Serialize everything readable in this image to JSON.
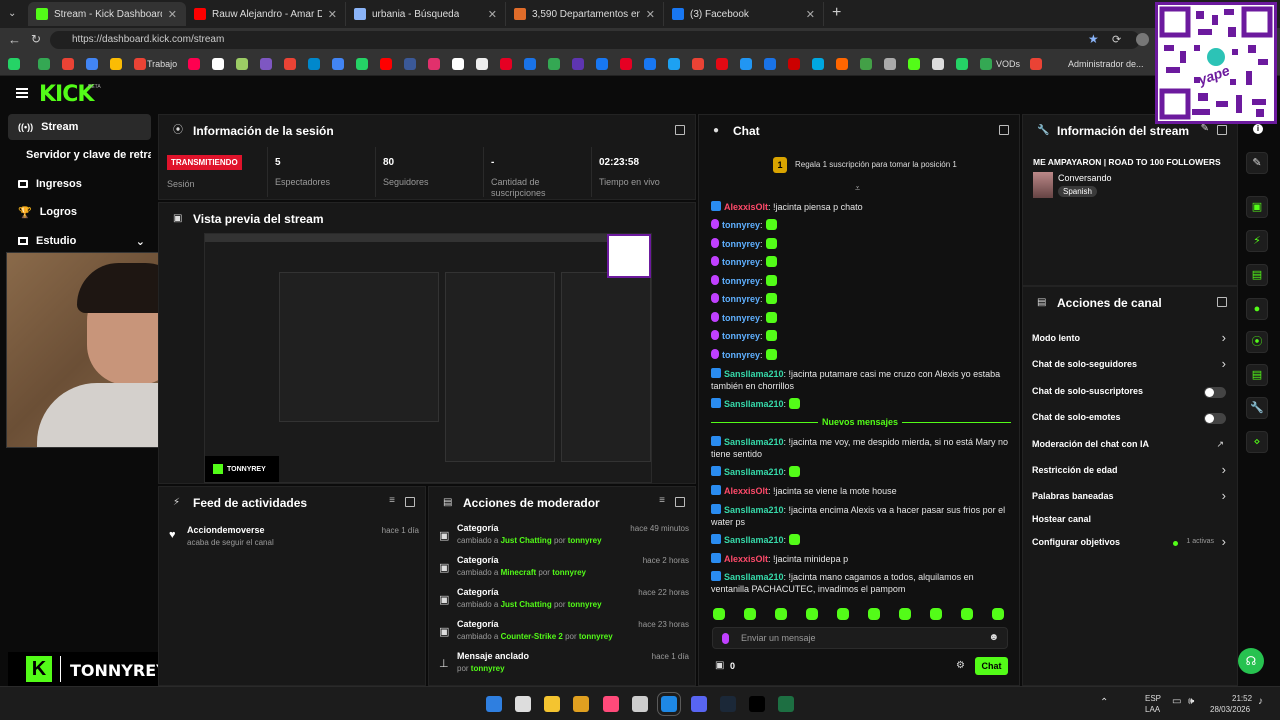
{
  "browser": {
    "tabs": [
      {
        "label": "Stream - Kick Dashboard",
        "color": "#53fc18"
      },
      {
        "label": "Rauw Alejandro - Amar De Nuevo",
        "color": "#ff0000"
      },
      {
        "label": "urbania - Búsqueda",
        "color": "#8ab4f8"
      },
      {
        "label": "3,590 Departamentos en alquiler e",
        "color": "#e06c2a"
      },
      {
        "label": "(3) Facebook",
        "color": "#1877f2"
      }
    ],
    "new_tab": "+",
    "url": "https://dashboard.kick.com/stream",
    "bookmarks": {
      "trabajo": "Trabajo",
      "vods": "VODs",
      "admin": "Administrador de..."
    }
  },
  "qr_overlay": {
    "label": "yape"
  },
  "sidebar": {
    "logo": "KICK",
    "logo_sup": "BETA",
    "items": [
      {
        "label": "Stream"
      },
      {
        "label": "Servidor y clave de retransm"
      },
      {
        "label": "Ingresos"
      },
      {
        "label": "Logros"
      },
      {
        "label": "Estudio"
      }
    ],
    "channel_name": "TONNYREY"
  },
  "session": {
    "title": "Información de la sesión",
    "status": "TRANSMITIENDO",
    "status_label": "Sesión",
    "stats": [
      {
        "value": "5",
        "label": "Espectadores"
      },
      {
        "value": "80",
        "label": "Seguidores"
      },
      {
        "value": "-",
        "label": "Cantidad de suscripciones"
      },
      {
        "value": "02:23:58",
        "label": "Tiempo en vivo"
      }
    ]
  },
  "preview": {
    "title": "Vista previa del stream",
    "brand": "TONNYREY"
  },
  "activity": {
    "title": "Feed de actividades",
    "items": [
      {
        "name": "Acciondemoverse",
        "action": "acaba de seguir el canal",
        "time": "hace 1 día"
      }
    ]
  },
  "moderator": {
    "title": "Acciones de moderador",
    "items": [
      {
        "title": "Categoría",
        "pre": "cambiado a",
        "value": "Just Chatting",
        "by": "por",
        "user": "tonnyrey",
        "time": "hace 49 minutos"
      },
      {
        "title": "Categoría",
        "pre": "cambiado a",
        "value": "Minecraft",
        "by": "por",
        "user": "tonnyrey",
        "time": "hace 2 horas"
      },
      {
        "title": "Categoría",
        "pre": "cambiado a",
        "value": "Just Chatting",
        "by": "por",
        "user": "tonnyrey",
        "time": "hace 22 horas"
      },
      {
        "title": "Categoría",
        "pre": "cambiado a",
        "value": "Counter-Strike 2",
        "by": "por",
        "user": "tonnyrey",
        "time": "hace 23 horas"
      },
      {
        "title": "Mensaje anclado",
        "pre": "",
        "value": "",
        "by": "por",
        "user": "tonnyrey",
        "time": "hace 1 día"
      }
    ]
  },
  "chat": {
    "title": "Chat",
    "gift_rank": "1",
    "gift_text": "Regala 1 suscripción para tomar la posición 1",
    "messages": [
      {
        "user": "AlexxisOlt",
        "cls": "u-red",
        "badge": "badge",
        "text": ": !jacinta piensa p chato"
      },
      {
        "user": "tonnyrey",
        "cls": "u-blue",
        "badge": "mic",
        "text": ":",
        "emote": true
      },
      {
        "user": "tonnyrey",
        "cls": "u-blue",
        "badge": "mic",
        "text": ":",
        "emote": true
      },
      {
        "user": "tonnyrey",
        "cls": "u-blue",
        "badge": "mic",
        "text": ":",
        "emote": true
      },
      {
        "user": "tonnyrey",
        "cls": "u-blue",
        "badge": "mic",
        "text": ":",
        "emote": true
      },
      {
        "user": "tonnyrey",
        "cls": "u-blue",
        "badge": "mic",
        "text": ":",
        "emote": true
      },
      {
        "user": "tonnyrey",
        "cls": "u-blue",
        "badge": "mic",
        "text": ":",
        "emote": true
      },
      {
        "user": "tonnyrey",
        "cls": "u-blue",
        "badge": "mic",
        "text": ":",
        "emote": true
      },
      {
        "user": "tonnyrey",
        "cls": "u-blue",
        "badge": "mic",
        "text": ":",
        "emote": true
      },
      {
        "user": "Sansllama210",
        "cls": "u-teal",
        "badge": "badge",
        "text": ": !jacinta putamare casi me cruzo con Alexis yo estaba también en chorrillos"
      },
      {
        "user": "Sansllama210",
        "cls": "u-teal",
        "badge": "badge",
        "text": ":",
        "emote": true
      }
    ],
    "new_messages": "Nuevos mensajes",
    "messages2": [
      {
        "user": "Sansllama210",
        "cls": "u-teal",
        "badge": "badge",
        "text": ": !jacinta me voy, me despido mierda, si no está Mary no tiene sentido"
      },
      {
        "user": "Sansllama210",
        "cls": "u-teal",
        "badge": "badge",
        "text": ":",
        "emote": true
      },
      {
        "user": "AlexxisOlt",
        "cls": "u-red",
        "badge": "badge",
        "text": ": !jacinta se viene la mote house"
      },
      {
        "user": "Sansllama210",
        "cls": "u-teal",
        "badge": "badge",
        "text": ": !jacinta encima Alexis va a hacer pasar sus frios por el water ps"
      },
      {
        "user": "Sansllama210",
        "cls": "u-teal",
        "badge": "badge",
        "text": ":",
        "emote": true
      },
      {
        "user": "AlexxisOlt",
        "cls": "u-red",
        "badge": "badge",
        "text": ": !jacinta minidepa p"
      },
      {
        "user": "Sansllama210",
        "cls": "u-teal",
        "badge": "badge",
        "text": ": !jacinta mano cagamos a todos, alquilamos en ventanilla PACHACUTEC, invadimos el pampom"
      }
    ],
    "placeholder": "Enviar un mensaje",
    "points": "0",
    "send": "Chat"
  },
  "stream_info": {
    "title": "Información del stream",
    "stream_title": "ME AMPAYARON | ROAD TO 100 FOLLOWERS",
    "category": "Conversando",
    "language": "Spanish"
  },
  "channel_actions": {
    "title": "Acciones de canal",
    "items": [
      {
        "label": "Modo lento",
        "ctrl": "chev"
      },
      {
        "label": "Chat de solo-seguidores",
        "ctrl": "chev"
      },
      {
        "label": "Chat de solo-suscriptores",
        "ctrl": "toggle"
      },
      {
        "label": "Chat de solo-emotes",
        "ctrl": "toggle"
      },
      {
        "label": "Moderación del chat con IA",
        "ctrl": "ext"
      },
      {
        "label": "Restricción de edad",
        "ctrl": "chev"
      },
      {
        "label": "Palabras baneadas",
        "ctrl": "chev"
      },
      {
        "label": "Hostear canal",
        "ctrl": "none"
      },
      {
        "label": "Configurar objetivos",
        "ctrl": "chev"
      }
    ],
    "goals_active": "1 activas"
  },
  "taskbar": {
    "lang1": "ESP",
    "lang2": "LAA",
    "time": "21:52",
    "date": "28/03/2026"
  },
  "colors": {
    "accent": "#53fc18",
    "live": "#e0132b"
  }
}
